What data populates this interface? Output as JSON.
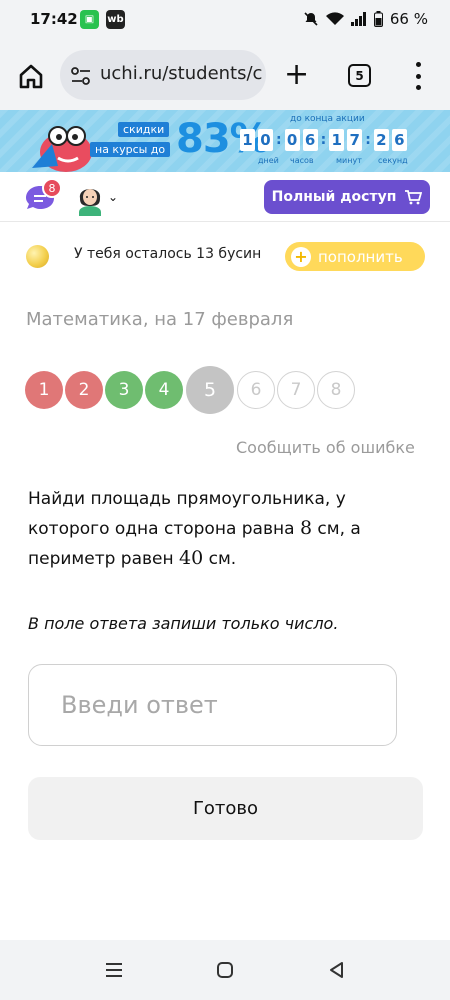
{
  "status": {
    "time": "17:42",
    "app_icon_1": "green-app-icon",
    "app_icon_2_label": "wb",
    "battery": "66 %"
  },
  "browser": {
    "url": "uchi.ru/students/c",
    "tab_count": "5"
  },
  "promo": {
    "label_1": "скидки",
    "label_2": "на курсы до",
    "big_text": "83%",
    "until_text": "до конца акции",
    "countdown": [
      "1",
      "0",
      "0",
      "6",
      "1",
      "7",
      "2",
      "6"
    ],
    "days_label": "дней",
    "hours_label": "часов",
    "minutes_label": "минут",
    "seconds_label": "секунд",
    "color": "#8fd3ef"
  },
  "header": {
    "chat_badge": "8",
    "full_access_label": "Полный доступ"
  },
  "beads": {
    "text": "У тебя осталось 13 бусин",
    "refill_label": "пополнить"
  },
  "subject": "Математика, на 17 февраля",
  "tasks": [
    {
      "label": "1",
      "state": "wrong"
    },
    {
      "label": "2",
      "state": "wrong"
    },
    {
      "label": "3",
      "state": "right"
    },
    {
      "label": "4",
      "state": "right"
    },
    {
      "label": "5",
      "state": "current"
    },
    {
      "label": "6",
      "state": "future"
    },
    {
      "label": "7",
      "state": "future"
    },
    {
      "label": "8",
      "state": "future"
    }
  ],
  "report_label": "Сообщить об ошибке",
  "question": {
    "part1": "Найди площадь прямоугольника, у которого одна сторона равна ",
    "num1": "8",
    "part2": " см, а периметр равен ",
    "num2": "40",
    "part3": " см."
  },
  "hint": "В поле ответа запиши только число.",
  "answer": {
    "value": "",
    "placeholder": "Введи ответ"
  },
  "done_label": "Готово",
  "colors": {
    "accent": "#6b4fcf",
    "wrong": "#e07777",
    "right": "#6fbd70",
    "bead_button": "#ffd95a"
  }
}
